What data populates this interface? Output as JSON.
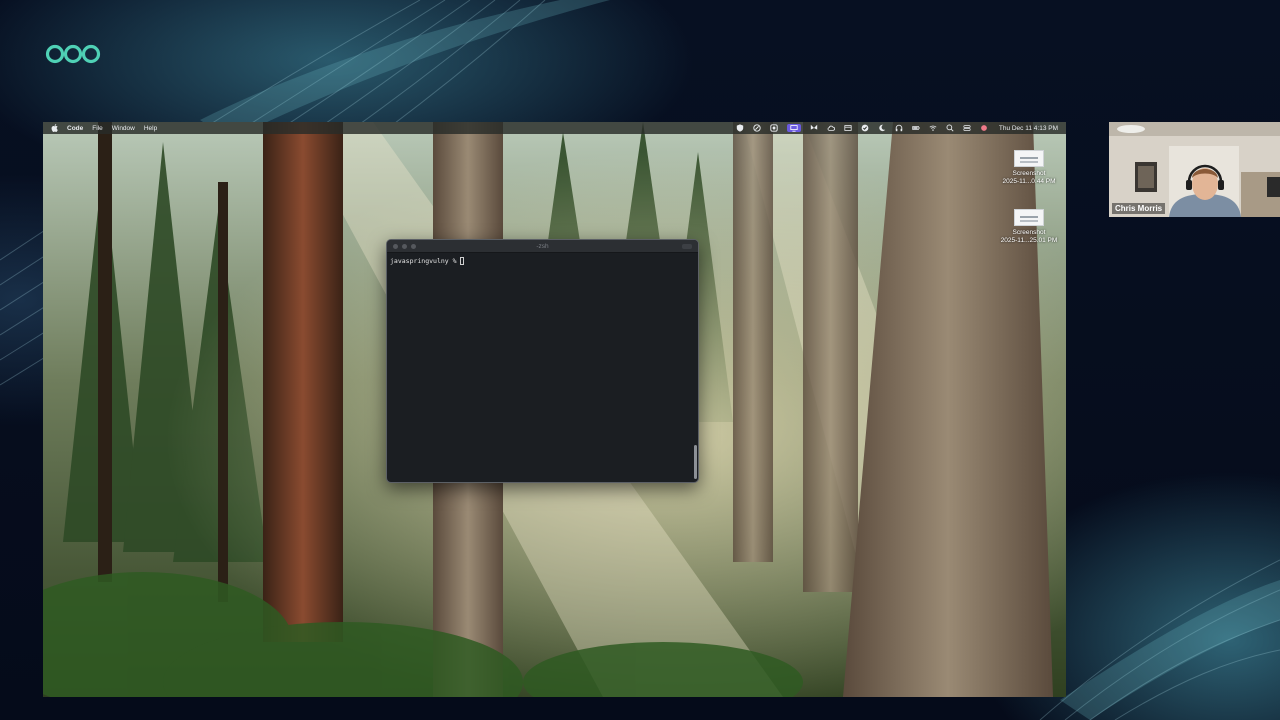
{
  "menubar": {
    "app_name": "Code",
    "menus": [
      "File",
      "Window",
      "Help"
    ],
    "clock": "Thu Dec 11  4:13 PM"
  },
  "desktop_files": [
    {
      "name": "Screenshot",
      "date": "2025-11...0.44 PM"
    },
    {
      "name": "Screenshot",
      "date": "2025-11...25.01 PM"
    }
  ],
  "terminal": {
    "title": "-zsh",
    "prompt": "javaspringvulny %"
  },
  "video": {
    "participant_name": "Chris Morris"
  },
  "colors": {
    "brand_accent": "#4fd1b5",
    "status_highlight": "#6a5ae0",
    "terminal_bg": "#1b1e22"
  }
}
